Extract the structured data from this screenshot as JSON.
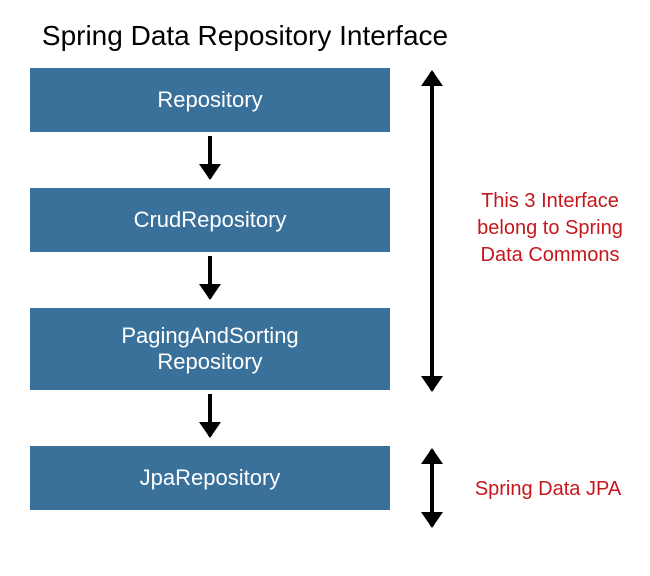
{
  "title": "Spring Data Repository Interface",
  "boxes": {
    "repository": "Repository",
    "crud": "CrudRepository",
    "paging_line1": "PagingAndSorting",
    "paging_line2": "Repository",
    "jpa": "JpaRepository"
  },
  "annotations": {
    "commons_line1": "This 3 Interface",
    "commons_line2": "belong to Spring",
    "commons_line3": "Data Commons",
    "jpa": "Spring Data JPA"
  },
  "colors": {
    "box_bg": "#3a719b",
    "annotation": "#c5161c"
  }
}
